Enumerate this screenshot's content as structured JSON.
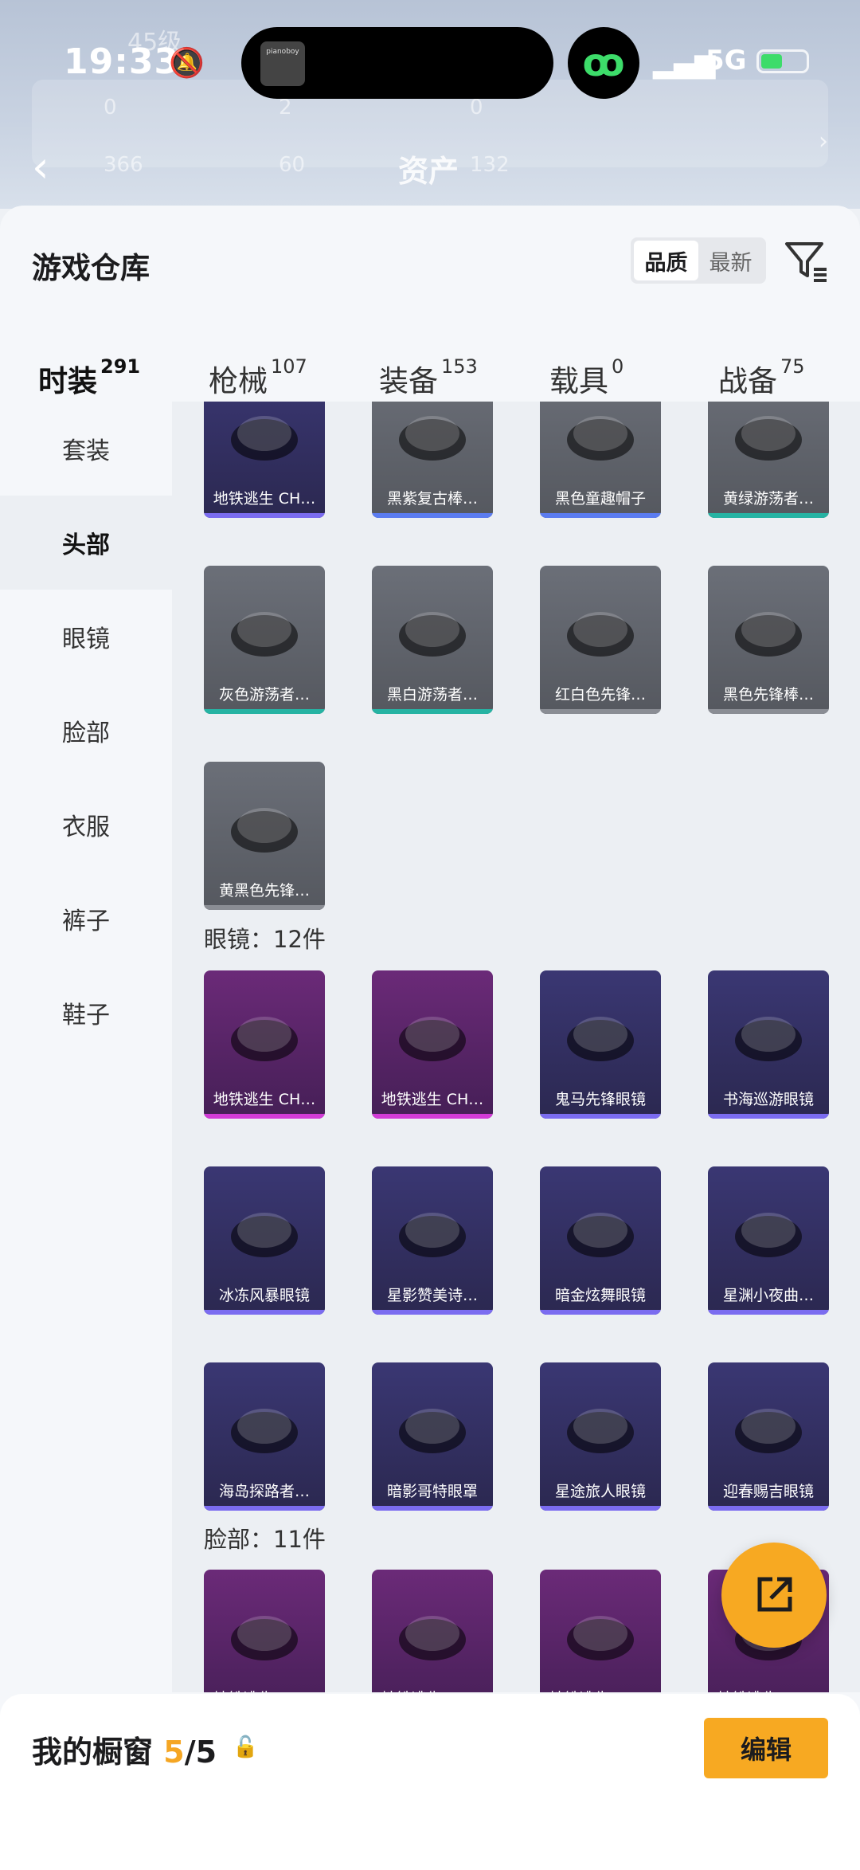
{
  "status": {
    "time": "19:33",
    "network": "5G",
    "island_text": "pianoboy"
  },
  "header_bg": {
    "level": "45级",
    "asset_title": "资产",
    "stats": [
      "0",
      "2",
      "0",
      "366",
      "60",
      "132"
    ]
  },
  "warehouse": {
    "title": "游戏仓库",
    "sort": {
      "options": [
        "品质",
        "最新"
      ],
      "selected": "品质"
    },
    "tabs": [
      {
        "label": "时装",
        "count": "291",
        "active": true
      },
      {
        "label": "枪械",
        "count": "107",
        "active": false
      },
      {
        "label": "装备",
        "count": "153",
        "active": false
      },
      {
        "label": "载具",
        "count": "0",
        "active": false
      },
      {
        "label": "战备",
        "count": "75",
        "active": false
      }
    ],
    "sidebar": [
      "套装",
      "头部",
      "眼镜",
      "脸部",
      "衣服",
      "裤子",
      "鞋子"
    ],
    "sidebar_active": "头部",
    "sections": [
      {
        "title": "",
        "items": [
          {
            "label": "地铁逃生 CH…",
            "quality": "purple"
          },
          {
            "label": "黑紫复古棒…",
            "quality": "gray-blue"
          },
          {
            "label": "黑色童趣帽子",
            "quality": "gray-blue"
          },
          {
            "label": "黄绿游荡者…",
            "quality": "gray-teal"
          },
          {
            "label": "灰色游荡者…",
            "quality": "gray-teal"
          },
          {
            "label": "黑白游荡者…",
            "quality": "gray-teal"
          },
          {
            "label": "红白色先锋…",
            "quality": "gray"
          },
          {
            "label": "黑色先锋棒…",
            "quality": "gray"
          },
          {
            "label": "黄黑色先锋…",
            "quality": "gray"
          }
        ]
      },
      {
        "title": "眼镜：12件",
        "items": [
          {
            "label": "地铁逃生 CH…",
            "quality": "magenta"
          },
          {
            "label": "地铁逃生 CH…",
            "quality": "magenta"
          },
          {
            "label": "鬼马先锋眼镜",
            "quality": "purple"
          },
          {
            "label": "书海巡游眼镜",
            "quality": "purple"
          },
          {
            "label": "冰冻风暴眼镜",
            "quality": "purple"
          },
          {
            "label": "星影赞美诗…",
            "quality": "purple"
          },
          {
            "label": "暗金炫舞眼镜",
            "quality": "purple"
          },
          {
            "label": "星渊小夜曲…",
            "quality": "purple"
          },
          {
            "label": "海岛探路者…",
            "quality": "purple"
          },
          {
            "label": "暗影哥特眼罩",
            "quality": "purple"
          },
          {
            "label": "星途旅人眼镜",
            "quality": "purple"
          },
          {
            "label": "迎春赐吉眼镜",
            "quality": "purple"
          }
        ]
      },
      {
        "title": "脸部：11件",
        "items": [
          {
            "label": "地铁逃生 CH…",
            "quality": "magenta"
          },
          {
            "label": "地铁逃生 CH…",
            "quality": "magenta"
          },
          {
            "label": "地铁逃生 CH…",
            "quality": "magenta"
          },
          {
            "label": "地铁逃生 CH…",
            "quality": "magenta"
          }
        ]
      }
    ]
  },
  "showcase": {
    "label": "我的橱窗",
    "count": "5",
    "sep": "/",
    "total": "5",
    "edit": "编辑"
  },
  "colors": {
    "accent": "#F7A922",
    "purple_bar": "#7b6cf0",
    "magenta_bar": "#d23bd6",
    "teal_bar": "#26b3a3",
    "blue_bar": "#5b7cf0"
  }
}
